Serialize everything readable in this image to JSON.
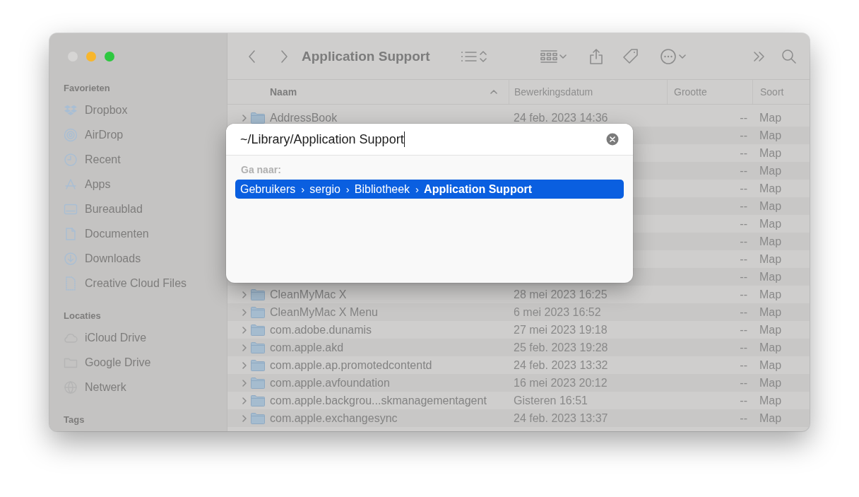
{
  "window": {
    "title": "Application Support",
    "traffic_lights": [
      {
        "color": "#d6d5d4"
      },
      {
        "color": "#f8b62c"
      },
      {
        "color": "#2ec840"
      }
    ]
  },
  "sidebar": {
    "sections": [
      {
        "heading": "Favorieten",
        "items": [
          {
            "label": "Dropbox",
            "kind": "dropbox"
          },
          {
            "label": "AirDrop",
            "kind": "airdrop"
          },
          {
            "label": "Recent",
            "kind": "clock"
          },
          {
            "label": "Apps",
            "kind": "apps"
          },
          {
            "label": "Bureaublad",
            "kind": "desktop"
          },
          {
            "label": "Documenten",
            "kind": "document"
          },
          {
            "label": "Downloads",
            "kind": "download"
          },
          {
            "label": "Creative Cloud Files",
            "kind": "file"
          }
        ]
      },
      {
        "heading": "Locaties",
        "items": [
          {
            "label": "iCloud Drive",
            "kind": "cloud"
          },
          {
            "label": "Google Drive",
            "kind": "folder"
          },
          {
            "label": "Netwerk",
            "kind": "globe"
          }
        ]
      },
      {
        "heading": "Tags"
      }
    ]
  },
  "table": {
    "columns": [
      {
        "label": "Naam",
        "sorted": true
      },
      {
        "label": "Bewerkingsdatum",
        "sorted": false
      },
      {
        "label": "Grootte",
        "sorted": false
      },
      {
        "label": "Soort",
        "sorted": false
      }
    ],
    "rows": [
      {
        "name": "AddressBook",
        "date": "24 feb. 2023 14:36",
        "size": "--",
        "type": "Map"
      },
      {
        "size": "--",
        "type": "Map"
      },
      {
        "size": "--",
        "type": "Map"
      },
      {
        "size": "--",
        "type": "Map"
      },
      {
        "size": "--",
        "type": "Map"
      },
      {
        "size": "--",
        "type": "Map"
      },
      {
        "size": "--",
        "type": "Map"
      },
      {
        "size": "--",
        "type": "Map"
      },
      {
        "size": "--",
        "type": "Map"
      },
      {
        "size": "--",
        "type": "Map"
      },
      {
        "name": "CleanMyMac X",
        "date": "28 mei 2023 16:25",
        "size": "--",
        "type": "Map"
      },
      {
        "name": "CleanMyMac X Menu",
        "date": "6 mei 2023 16:52",
        "size": "--",
        "type": "Map"
      },
      {
        "name": "com.adobe.dunamis",
        "date": "27 mei 2023 19:18",
        "size": "--",
        "type": "Map"
      },
      {
        "name": "com.apple.akd",
        "date": "25 feb. 2023 19:28",
        "size": "--",
        "type": "Map"
      },
      {
        "name": "com.apple.ap.promotedcontentd",
        "date": "24 feb. 2023 13:32",
        "size": "--",
        "type": "Map"
      },
      {
        "name": "com.apple.avfoundation",
        "date": "16 mei 2023 20:12",
        "size": "--",
        "type": "Map"
      },
      {
        "name": "com.apple.backgrou...skmanagementagent",
        "date": "Gisteren 16:51",
        "size": "--",
        "type": "Map"
      },
      {
        "name": "com.apple.exchangesync",
        "date": "24 feb. 2023 13:37",
        "size": "--",
        "type": "Map"
      }
    ]
  },
  "go_to_dialog": {
    "path_value": "~/Library/Application Support",
    "section_label": "Ga naar:",
    "separator": "›",
    "results": [
      {
        "segments": [
          "Gebruikers",
          "sergio",
          "Bibliotheek",
          "Application Support"
        ],
        "selected": true
      }
    ]
  }
}
